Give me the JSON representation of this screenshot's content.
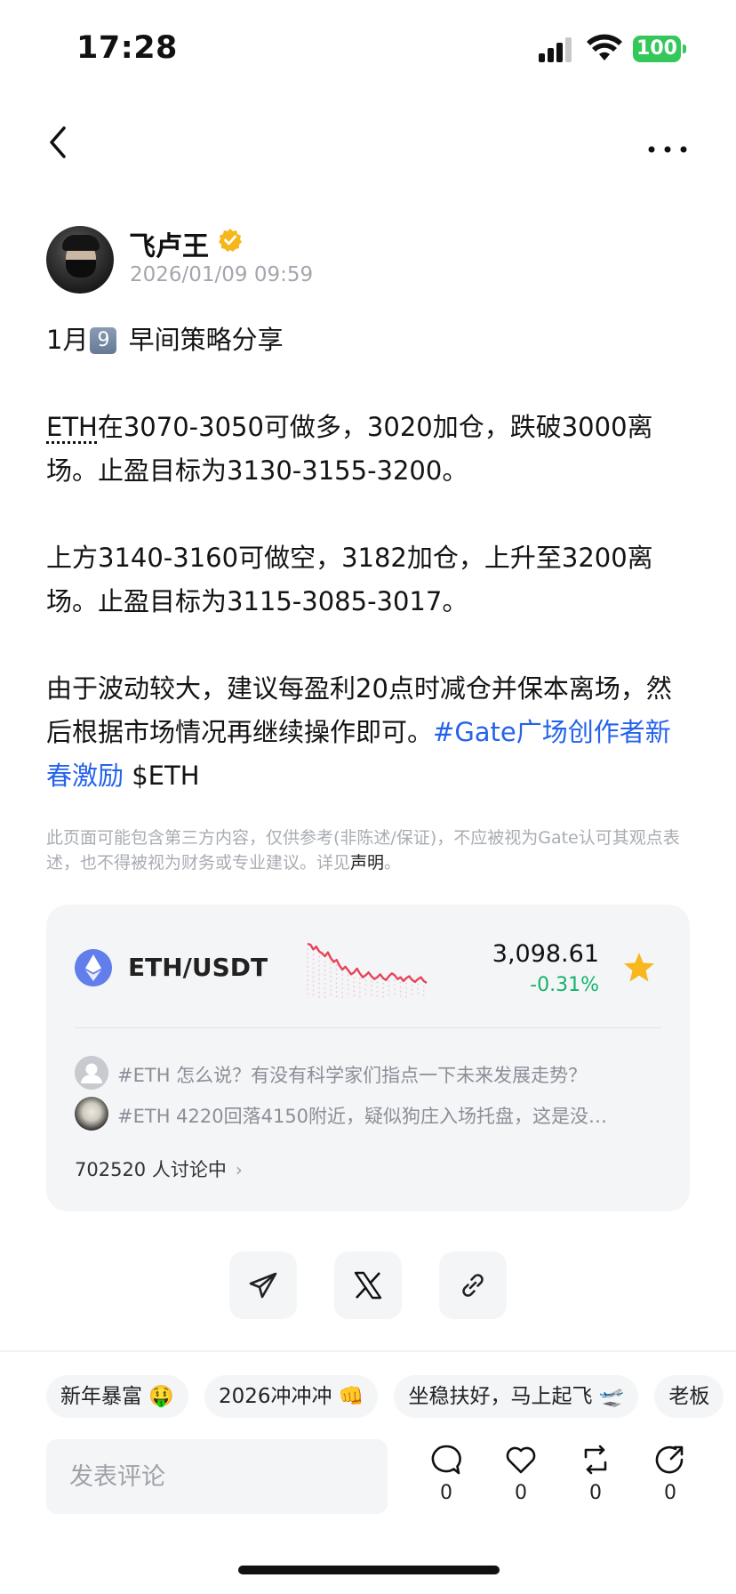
{
  "status_bar": {
    "time": "17:28",
    "battery": "100"
  },
  "nav": {
    "back_icon": "chevron-left-icon",
    "more_icon": "ellipsis-icon"
  },
  "author": {
    "name": "飞卢王",
    "verified": true,
    "timestamp": "2026/01/09 09:59"
  },
  "post": {
    "line1_prefix": "1月",
    "line1_keycap": "9",
    "line1_suffix": " 早间策略分享",
    "p2_eth": "ETH",
    "p2_rest": "在3070-3050可做多，3020加仓，跌破3000离场。止盈目标为3130-3155-3200。",
    "p3": "上方3140-3160可做空，3182加仓，上升至3200离场。止盈目标为3115-3085-3017。",
    "p4": "由于波动较大，建议每盈利20点时减仓并保本离场，然后根据市场情况再继续操作即可。",
    "hashtag": "#Gate广场创作者新春激励",
    "cashtag": " $ETH"
  },
  "disclaimer": {
    "text": "此页面可能包含第三方内容，仅供参考(非陈述/保证)，不应被视为Gate认可其观点表述，也不得被视为财务或专业建议。详见",
    "link": "声明",
    "end": "。"
  },
  "market_card": {
    "pair": "ETH/USDT",
    "price": "3,098.61",
    "change": "-0.31%",
    "spark_points": [
      3,
      4,
      9,
      6,
      11,
      13,
      16,
      12,
      18,
      22,
      20,
      26,
      30,
      27,
      31,
      35,
      33,
      29,
      34,
      38,
      36,
      33,
      37,
      40,
      38,
      35,
      39,
      41,
      37,
      34,
      36,
      40,
      38,
      42,
      39,
      37,
      41,
      43,
      40,
      38,
      42,
      44
    ],
    "topics": [
      {
        "text": "#ETH 怎么说？有没有科学家们指点一下未来发展走势？",
        "avatar": "person-avatar-icon"
      },
      {
        "text": "#ETH 4220回落4150附近，疑似狗庄入场托盘，这是没…",
        "avatar": "anonymous-avatar-icon"
      }
    ],
    "discussion": "702520 人讨论中",
    "accent": "#2463eb",
    "down_color": "#14b36b",
    "spark_color": "#e8435a"
  },
  "share": {
    "buttons": [
      "telegram-icon",
      "x-icon",
      "link-icon"
    ]
  },
  "chips": [
    "新年暴富 🤑",
    "2026冲冲冲 👊",
    "坐稳扶好，马上起飞 🛫",
    "老板"
  ],
  "comment_bar": {
    "placeholder": "发表评论",
    "actions": [
      {
        "icon": "comment-icon",
        "count": "0"
      },
      {
        "icon": "heart-icon",
        "count": "0"
      },
      {
        "icon": "repost-icon",
        "count": "0"
      },
      {
        "icon": "share-icon",
        "count": "0"
      }
    ]
  }
}
